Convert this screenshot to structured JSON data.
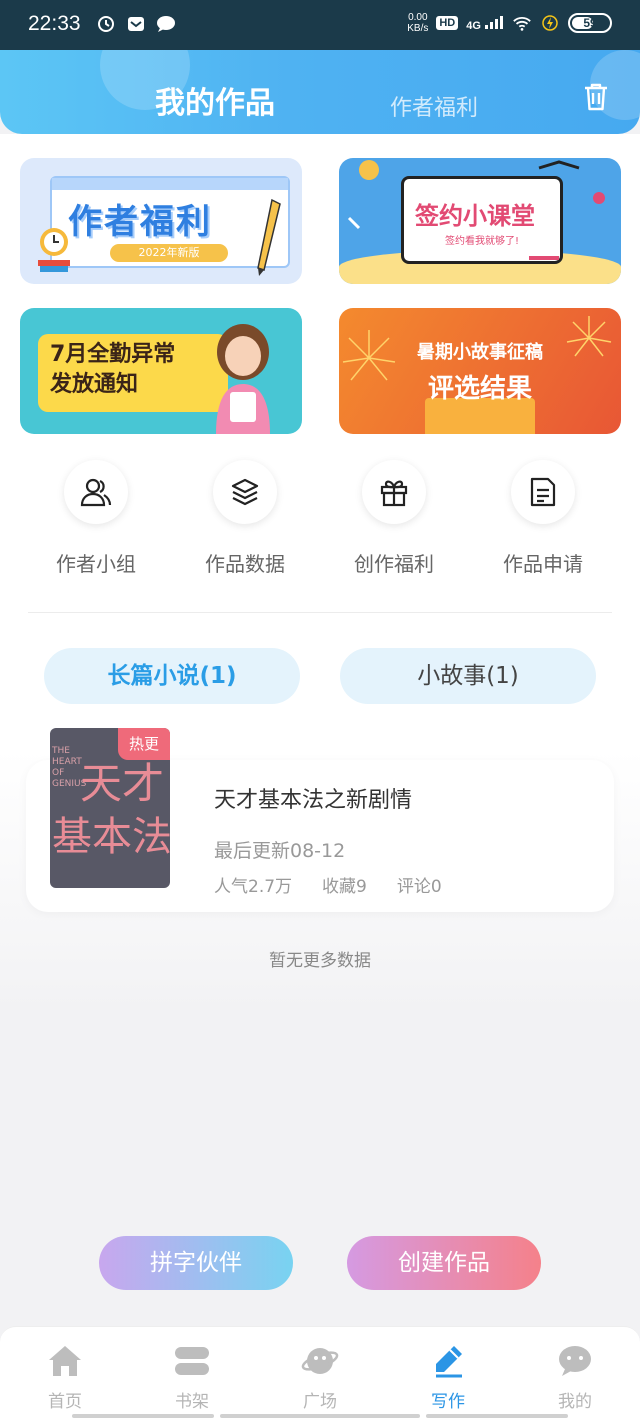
{
  "status_bar": {
    "time": "22:33",
    "net_speed_value": "0.00",
    "net_speed_unit": "KB/s",
    "hd": "HD",
    "network": "4G",
    "battery": "59",
    "battery_level": 0.59
  },
  "header": {
    "tab_active": "我的作品",
    "tab_inactive": "作者福利"
  },
  "banners": {
    "b1_title": "作者福利",
    "b1_pill": "2022年新版",
    "b2_title": "签约小课堂",
    "b2_sub": "签约看我就够了!",
    "b3_line1": "7月全勤异常",
    "b3_line2": "发放通知",
    "b4_line1": "暑期小故事征稿",
    "b4_line2": "评选结果"
  },
  "quick_nav": [
    {
      "label": "作者小组",
      "icon": "users-icon"
    },
    {
      "label": "作品数据",
      "icon": "layers-icon"
    },
    {
      "label": "创作福利",
      "icon": "gift-icon"
    },
    {
      "label": "作品申请",
      "icon": "document-icon"
    }
  ],
  "works_tabs": {
    "novel": "长篇小说(1)",
    "story": "小故事(1)"
  },
  "work": {
    "badge": "热更",
    "cover_en": "THE HEART OF GENIUS",
    "cover_cn_top": "天才",
    "cover_cn_bottom": "基本法",
    "title": "天才基本法之新剧情",
    "updated": "最后更新08-12",
    "popularity": "人气2.7万",
    "favorites": "收藏9",
    "comments": "评论0"
  },
  "no_more": "暂无更多数据",
  "buttons": {
    "partner": "拼字伙伴",
    "create": "创建作品"
  },
  "bottom_nav": [
    {
      "label": "首页",
      "icon": "home-icon"
    },
    {
      "label": "书架",
      "icon": "bookshelf-icon"
    },
    {
      "label": "广场",
      "icon": "planet-icon"
    },
    {
      "label": "写作",
      "icon": "pen-icon",
      "active": true
    },
    {
      "label": "我的",
      "icon": "chat-face-icon"
    }
  ],
  "colors": {
    "accent": "#2b95e5",
    "header": "#4fb2f2",
    "hot_badge": "#ef6a7a"
  }
}
